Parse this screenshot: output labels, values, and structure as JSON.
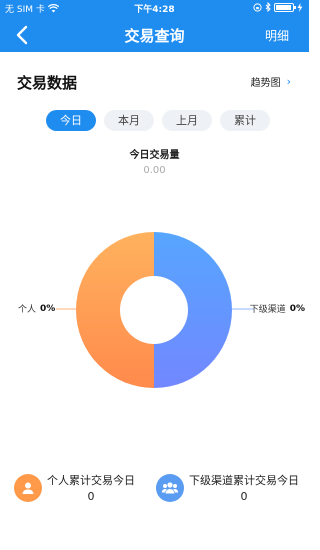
{
  "status_bar": {
    "carrier": "无 SIM 卡",
    "time": "下午4:28"
  },
  "header": {
    "title": "交易查询",
    "right_label": "明细",
    "back_icon": "back-arrow-icon"
  },
  "section": {
    "title": "交易数据",
    "trend_label": "趋势图",
    "trend_icon": "chevron-right-icon"
  },
  "tabs": [
    {
      "label": "今日",
      "active": true
    },
    {
      "label": "本月",
      "active": false
    },
    {
      "label": "上月",
      "active": false
    },
    {
      "label": "累计",
      "active": false
    }
  ],
  "metric": {
    "label": "今日交易量",
    "value": "0.00"
  },
  "chart_data": {
    "type": "pie",
    "slices": [
      {
        "name": "个人",
        "percent_label": "0%",
        "value": 0,
        "color": "#ff9a4a"
      },
      {
        "name": "下级渠道",
        "percent_label": "0%",
        "value": 0,
        "color": "#5aa2ff"
      }
    ]
  },
  "stats": [
    {
      "label": "个人累计交易今日",
      "value": "0",
      "icon": "person-icon",
      "color": "#ff9a4a"
    },
    {
      "label": "下级渠道累计交易今日",
      "value": "0",
      "icon": "group-icon",
      "color": "#5b9cf3"
    }
  ],
  "colors": {
    "primary": "#1f8cf0"
  }
}
